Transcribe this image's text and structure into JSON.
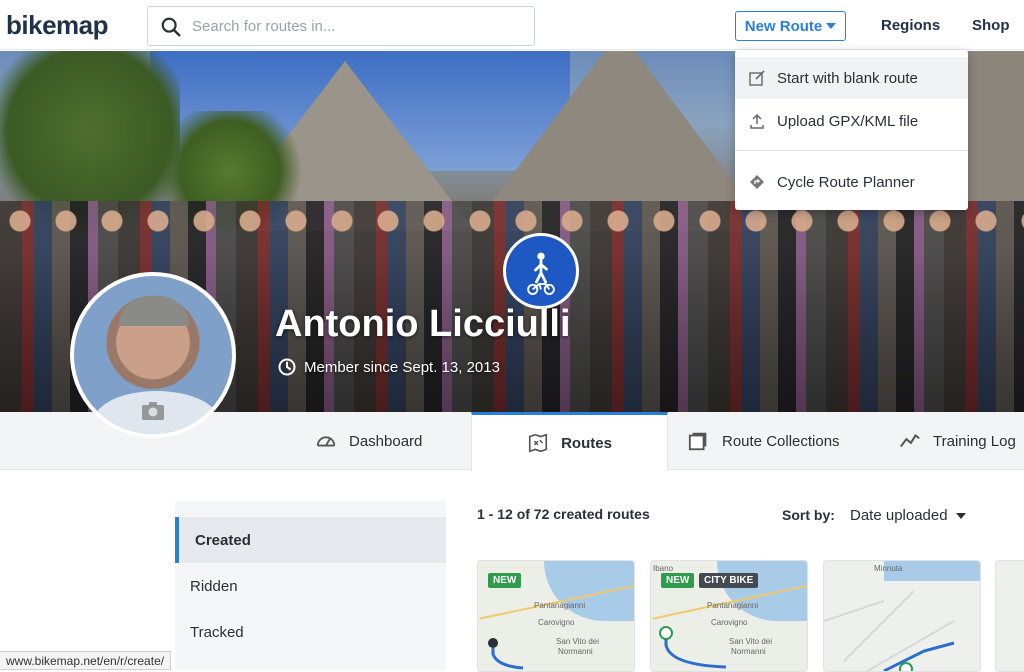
{
  "header": {
    "logo": "bikemap",
    "search_placeholder": "Search for routes in...",
    "new_route_label": "New Route",
    "nav": [
      "Regions",
      "Shop"
    ]
  },
  "new_route_menu": {
    "items": [
      {
        "label": "Start with blank route",
        "icon": "edit-icon"
      },
      {
        "label": "Upload GPX/KML file",
        "icon": "upload-icon"
      },
      {
        "label": "Cycle Route Planner",
        "icon": "route-planner-icon"
      }
    ]
  },
  "profile": {
    "name": "Antonio Licciulli",
    "member_since": "Member since Sept. 13, 2013"
  },
  "tabs": [
    {
      "label": "Dashboard",
      "icon": "speedometer-icon"
    },
    {
      "label": "Routes",
      "icon": "map-icon",
      "active": true
    },
    {
      "label": "Route Collections",
      "icon": "collections-icon"
    },
    {
      "label": "Training Log",
      "icon": "chart-icon"
    }
  ],
  "sidebar": {
    "items": [
      {
        "label": "Created",
        "active": true
      },
      {
        "label": "Ridden"
      },
      {
        "label": "Tracked"
      }
    ]
  },
  "routes": {
    "count_text": "1 - 12 of 72 created routes",
    "sort_label": "Sort by:",
    "sort_value": "Date uploaded",
    "cards": [
      {
        "badges": [
          "NEW"
        ],
        "places": [
          "Pantanagianni",
          "Carovigno",
          "San Vito dei",
          "Normanni"
        ]
      },
      {
        "badges": [
          "NEW",
          "CITY BIKE"
        ],
        "places": [
          "Ibano",
          "Pantanagianni",
          "Carovigno",
          "San Vito dei",
          "Normanni"
        ]
      },
      {
        "badges": [],
        "places": [
          "Minnuta"
        ]
      }
    ]
  },
  "status_bar": "www.bikemap.net/en/r/create/",
  "colors": {
    "accent": "#2a80d8",
    "brand": "#1f3247",
    "new_badge": "#2e9c4a"
  }
}
